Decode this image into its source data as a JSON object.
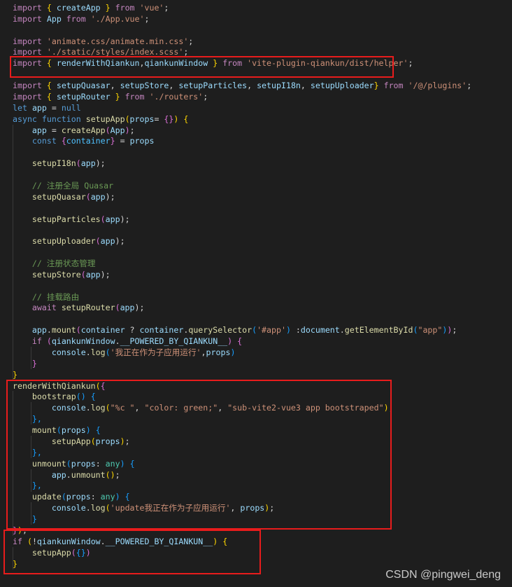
{
  "colors": {
    "background": "#1e1e1e",
    "plain": "#d4d4d4",
    "keyword": "#c586c0",
    "storage": "#569cd6",
    "string": "#ce9178",
    "function": "#dcdcaa",
    "variable": "#9cdcfe",
    "constant": "#4fc1ff",
    "type": "#4ec9b0",
    "comment": "#6a9955",
    "bracket1": "#ffd700",
    "bracket2": "#da70d6",
    "bracket3": "#179fff",
    "highlight_box": "#e81c1c"
  },
  "code_lines": [
    [
      [
        "import",
        "keyword"
      ],
      [
        " ",
        "plain"
      ],
      [
        "{",
        "bracket1"
      ],
      [
        " createApp ",
        "variable"
      ],
      [
        "}",
        "bracket1"
      ],
      [
        " ",
        "plain"
      ],
      [
        "from",
        "keyword"
      ],
      [
        " ",
        "plain"
      ],
      [
        "'vue'",
        "string"
      ],
      [
        ";",
        "plain"
      ]
    ],
    [
      [
        "import",
        "keyword"
      ],
      [
        " App ",
        "variable"
      ],
      [
        "from",
        "keyword"
      ],
      [
        " ",
        "plain"
      ],
      [
        "'./App.vue'",
        "string"
      ],
      [
        ";",
        "plain"
      ]
    ],
    [],
    [
      [
        "import",
        "keyword"
      ],
      [
        " ",
        "plain"
      ],
      [
        "'animate.css/animate.min.css'",
        "string"
      ],
      [
        ";",
        "plain"
      ]
    ],
    [
      [
        "import",
        "keyword"
      ],
      [
        " ",
        "plain"
      ],
      [
        "'./static/styles/index.scss'",
        "string"
      ],
      [
        ";",
        "plain"
      ]
    ],
    [
      [
        "import",
        "keyword"
      ],
      [
        " ",
        "plain"
      ],
      [
        "{",
        "bracket1"
      ],
      [
        " renderWithQiankun",
        "variable"
      ],
      [
        ",",
        "plain"
      ],
      [
        "qiankunWindow ",
        "variable"
      ],
      [
        "}",
        "bracket1"
      ],
      [
        " ",
        "plain"
      ],
      [
        "from",
        "keyword"
      ],
      [
        " ",
        "plain"
      ],
      [
        "'vite-plugin-qiankun/dist/helper'",
        "string"
      ],
      [
        ";",
        "plain"
      ]
    ],
    [],
    [
      [
        "import",
        "keyword"
      ],
      [
        " ",
        "plain"
      ],
      [
        "{",
        "bracket1"
      ],
      [
        " setupQuasar",
        "variable"
      ],
      [
        ", ",
        "plain"
      ],
      [
        "setupStore",
        "variable"
      ],
      [
        ", ",
        "plain"
      ],
      [
        "setupParticles",
        "variable"
      ],
      [
        ", ",
        "plain"
      ],
      [
        "setupI18n",
        "variable"
      ],
      [
        ", ",
        "plain"
      ],
      [
        "setupUploader",
        "variable"
      ],
      [
        "}",
        "bracket1"
      ],
      [
        " ",
        "plain"
      ],
      [
        "from",
        "keyword"
      ],
      [
        " ",
        "plain"
      ],
      [
        "'/@/plugins'",
        "string"
      ],
      [
        ";",
        "plain"
      ]
    ],
    [
      [
        "import",
        "keyword"
      ],
      [
        " ",
        "plain"
      ],
      [
        "{",
        "bracket1"
      ],
      [
        " setupRouter ",
        "variable"
      ],
      [
        "}",
        "bracket1"
      ],
      [
        " ",
        "plain"
      ],
      [
        "from",
        "keyword"
      ],
      [
        " ",
        "plain"
      ],
      [
        "'./routers'",
        "string"
      ],
      [
        ";",
        "plain"
      ]
    ],
    [
      [
        "let",
        "storage"
      ],
      [
        " ",
        "plain"
      ],
      [
        "app",
        "variable"
      ],
      [
        " = ",
        "plain"
      ],
      [
        "null",
        "storage"
      ]
    ],
    [
      [
        "async",
        "storage"
      ],
      [
        " ",
        "plain"
      ],
      [
        "function",
        "storage"
      ],
      [
        " ",
        "plain"
      ],
      [
        "setupApp",
        "function"
      ],
      [
        "(",
        "bracket1"
      ],
      [
        "props",
        "variable"
      ],
      [
        "= ",
        "plain"
      ],
      [
        "{}",
        "bracket2"
      ],
      [
        ")",
        "bracket1"
      ],
      [
        " ",
        "plain"
      ],
      [
        "{",
        "bracket1"
      ]
    ],
    [
      [
        "    ",
        "plain"
      ],
      [
        "app",
        "variable"
      ],
      [
        " = ",
        "plain"
      ],
      [
        "createApp",
        "function"
      ],
      [
        "(",
        "bracket2"
      ],
      [
        "App",
        "variable"
      ],
      [
        ")",
        "bracket2"
      ],
      [
        ";",
        "plain"
      ]
    ],
    [
      [
        "    ",
        "plain"
      ],
      [
        "const",
        "storage"
      ],
      [
        " ",
        "plain"
      ],
      [
        "{",
        "bracket2"
      ],
      [
        "container",
        "constant"
      ],
      [
        "}",
        "bracket2"
      ],
      [
        " = ",
        "plain"
      ],
      [
        "props",
        "variable"
      ]
    ],
    [],
    [
      [
        "    ",
        "plain"
      ],
      [
        "setupI18n",
        "function"
      ],
      [
        "(",
        "bracket2"
      ],
      [
        "app",
        "variable"
      ],
      [
        ");",
        "plain"
      ]
    ],
    [],
    [
      [
        "    ",
        "plain"
      ],
      [
        "// 注册全局 Quasar",
        "comment"
      ]
    ],
    [
      [
        "    ",
        "plain"
      ],
      [
        "setupQuasar",
        "function"
      ],
      [
        "(",
        "bracket2"
      ],
      [
        "app",
        "variable"
      ],
      [
        ");",
        "plain"
      ]
    ],
    [],
    [
      [
        "    ",
        "plain"
      ],
      [
        "setupParticles",
        "function"
      ],
      [
        "(",
        "bracket2"
      ],
      [
        "app",
        "variable"
      ],
      [
        ");",
        "plain"
      ]
    ],
    [],
    [
      [
        "    ",
        "plain"
      ],
      [
        "setupUploader",
        "function"
      ],
      [
        "(",
        "bracket2"
      ],
      [
        "app",
        "variable"
      ],
      [
        ");",
        "plain"
      ]
    ],
    [],
    [
      [
        "    ",
        "plain"
      ],
      [
        "// 注册状态管理",
        "comment"
      ]
    ],
    [
      [
        "    ",
        "plain"
      ],
      [
        "setupStore",
        "function"
      ],
      [
        "(",
        "bracket2"
      ],
      [
        "app",
        "variable"
      ],
      [
        ");",
        "plain"
      ]
    ],
    [],
    [
      [
        "    ",
        "plain"
      ],
      [
        "// 挂载路由",
        "comment"
      ]
    ],
    [
      [
        "    ",
        "plain"
      ],
      [
        "await",
        "keyword"
      ],
      [
        " ",
        "plain"
      ],
      [
        "setupRouter",
        "function"
      ],
      [
        "(",
        "bracket2"
      ],
      [
        "app",
        "variable"
      ],
      [
        ");",
        "plain"
      ]
    ],
    [],
    [
      [
        "    ",
        "plain"
      ],
      [
        "app",
        "variable"
      ],
      [
        ".",
        "plain"
      ],
      [
        "mount",
        "function"
      ],
      [
        "(",
        "bracket2"
      ],
      [
        "container",
        "variable"
      ],
      [
        " ? ",
        "plain"
      ],
      [
        "container",
        "variable"
      ],
      [
        ".",
        "plain"
      ],
      [
        "querySelector",
        "function"
      ],
      [
        "(",
        "bracket3"
      ],
      [
        "'#app'",
        "string"
      ],
      [
        ")",
        "bracket3"
      ],
      [
        " :",
        "plain"
      ],
      [
        "document",
        "variable"
      ],
      [
        ".",
        "plain"
      ],
      [
        "getElementById",
        "function"
      ],
      [
        "(",
        "bracket3"
      ],
      [
        "\"app\"",
        "string"
      ],
      [
        ")",
        "bracket3"
      ],
      [
        ")",
        "bracket2"
      ],
      [
        ";",
        "plain"
      ]
    ],
    [
      [
        "    ",
        "plain"
      ],
      [
        "if",
        "keyword"
      ],
      [
        " ",
        "plain"
      ],
      [
        "(",
        "bracket2"
      ],
      [
        "qiankunWindow",
        "variable"
      ],
      [
        ".",
        "plain"
      ],
      [
        "__POWERED_BY_QIANKUN__",
        "variable"
      ],
      [
        ")",
        "bracket2"
      ],
      [
        " ",
        "plain"
      ],
      [
        "{",
        "bracket2"
      ]
    ],
    [
      [
        "        ",
        "plain"
      ],
      [
        "console",
        "variable"
      ],
      [
        ".",
        "plain"
      ],
      [
        "log",
        "function"
      ],
      [
        "(",
        "bracket3"
      ],
      [
        "'我正在作为子应用运行'",
        "string"
      ],
      [
        ",",
        "plain"
      ],
      [
        "props",
        "variable"
      ],
      [
        ")",
        "bracket3"
      ]
    ],
    [
      [
        "    ",
        "plain"
      ],
      [
        "}",
        "bracket2"
      ]
    ],
    [
      [
        "}",
        "bracket1"
      ]
    ],
    [
      [
        "renderWithQiankun",
        "function"
      ],
      [
        "(",
        "bracket1"
      ],
      [
        "{",
        "bracket2"
      ]
    ],
    [
      [
        "    ",
        "plain"
      ],
      [
        "bootstrap",
        "function"
      ],
      [
        "()",
        "bracket3"
      ],
      [
        " ",
        "plain"
      ],
      [
        "{",
        "bracket3"
      ]
    ],
    [
      [
        "        ",
        "plain"
      ],
      [
        "console",
        "variable"
      ],
      [
        ".",
        "plain"
      ],
      [
        "log",
        "function"
      ],
      [
        "(",
        "bracket1"
      ],
      [
        "\"%c \"",
        "string"
      ],
      [
        ", ",
        "plain"
      ],
      [
        "\"color: green;\"",
        "string"
      ],
      [
        ", ",
        "plain"
      ],
      [
        "\"sub-vite2-vue3 app bootstraped\"",
        "string"
      ],
      [
        ")",
        "bracket1"
      ],
      [
        ";",
        "plain"
      ]
    ],
    [
      [
        "    ",
        "plain"
      ],
      [
        "},",
        "bracket3"
      ]
    ],
    [
      [
        "    ",
        "plain"
      ],
      [
        "mount",
        "function"
      ],
      [
        "(",
        "bracket3"
      ],
      [
        "props",
        "variable"
      ],
      [
        ")",
        "bracket3"
      ],
      [
        " ",
        "plain"
      ],
      [
        "{",
        "bracket3"
      ]
    ],
    [
      [
        "        ",
        "plain"
      ],
      [
        "setupApp",
        "function"
      ],
      [
        "(",
        "bracket1"
      ],
      [
        "props",
        "variable"
      ],
      [
        ")",
        "bracket1"
      ],
      [
        ";",
        "plain"
      ]
    ],
    [
      [
        "    ",
        "plain"
      ],
      [
        "},",
        "bracket3"
      ]
    ],
    [
      [
        "    ",
        "plain"
      ],
      [
        "unmount",
        "function"
      ],
      [
        "(",
        "bracket3"
      ],
      [
        "props",
        "variable"
      ],
      [
        ": ",
        "plain"
      ],
      [
        "any",
        "type"
      ],
      [
        ")",
        "bracket3"
      ],
      [
        " ",
        "plain"
      ],
      [
        "{",
        "bracket3"
      ]
    ],
    [
      [
        "        ",
        "plain"
      ],
      [
        "app",
        "variable"
      ],
      [
        ".",
        "plain"
      ],
      [
        "unmount",
        "function"
      ],
      [
        "()",
        "bracket1"
      ],
      [
        ";",
        "plain"
      ]
    ],
    [
      [
        "    ",
        "plain"
      ],
      [
        "},",
        "bracket3"
      ]
    ],
    [
      [
        "    ",
        "plain"
      ],
      [
        "update",
        "function"
      ],
      [
        "(",
        "bracket3"
      ],
      [
        "props",
        "variable"
      ],
      [
        ": ",
        "plain"
      ],
      [
        "any",
        "type"
      ],
      [
        ")",
        "bracket3"
      ],
      [
        " ",
        "plain"
      ],
      [
        "{",
        "bracket3"
      ]
    ],
    [
      [
        "        ",
        "plain"
      ],
      [
        "console",
        "variable"
      ],
      [
        ".",
        "plain"
      ],
      [
        "log",
        "function"
      ],
      [
        "(",
        "bracket1"
      ],
      [
        "'update我正在作为子应用运行'",
        "string"
      ],
      [
        ", ",
        "plain"
      ],
      [
        "props",
        "variable"
      ],
      [
        ")",
        "bracket1"
      ],
      [
        ";",
        "plain"
      ]
    ],
    [
      [
        "    ",
        "plain"
      ],
      [
        "}",
        "bracket3"
      ]
    ],
    [
      [
        "}",
        "bracket2"
      ],
      [
        ")",
        "bracket1"
      ],
      [
        ";",
        "plain"
      ]
    ],
    [
      [
        "if",
        "keyword"
      ],
      [
        " ",
        "plain"
      ],
      [
        "(",
        "bracket1"
      ],
      [
        "!",
        "plain"
      ],
      [
        "qiankunWindow",
        "variable"
      ],
      [
        ".",
        "plain"
      ],
      [
        "__POWERED_BY_QIANKUN__",
        "variable"
      ],
      [
        ")",
        "bracket1"
      ],
      [
        " ",
        "plain"
      ],
      [
        "{",
        "bracket1"
      ]
    ],
    [
      [
        "    ",
        "plain"
      ],
      [
        "setupApp",
        "function"
      ],
      [
        "(",
        "bracket2"
      ],
      [
        "{}",
        "bracket3"
      ],
      [
        ")",
        "bracket2"
      ]
    ],
    [
      [
        "}",
        "bracket1"
      ]
    ]
  ],
  "watermark": "CSDN @pingwei_deng"
}
